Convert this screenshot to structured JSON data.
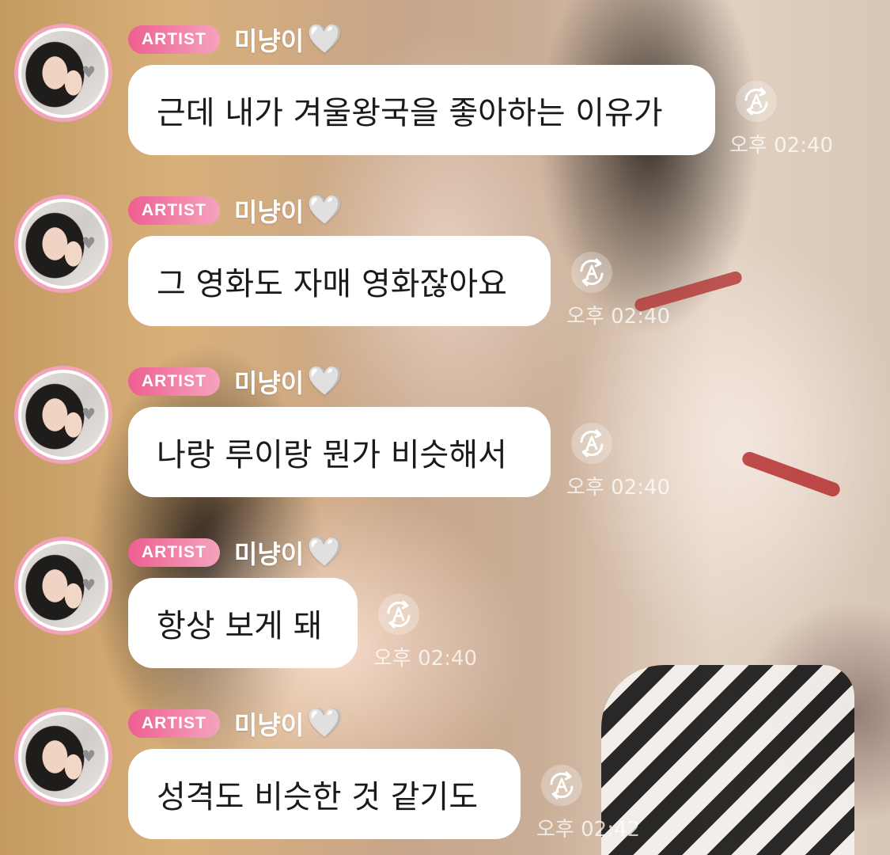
{
  "messages": [
    {
      "badge": "ARTIST",
      "name": "미냥이",
      "heart": "🤍",
      "text": "근데 내가 겨울왕국을 좋아하는 이유가",
      "time": "오후 02:40",
      "translate_icon": "translate-icon"
    },
    {
      "badge": "ARTIST",
      "name": "미냥이",
      "heart": "🤍",
      "text": "그 영화도 자매 영화잖아요",
      "time": "오후 02:40",
      "translate_icon": "translate-icon"
    },
    {
      "badge": "ARTIST",
      "name": "미냥이",
      "heart": "🤍",
      "text": "나랑 루이랑 뭔가 비슷해서",
      "time": "오후 02:40",
      "translate_icon": "translate-icon"
    },
    {
      "badge": "ARTIST",
      "name": "미냥이",
      "heart": "🤍",
      "text": "항상 보게 돼",
      "time": "오후 02:40",
      "translate_icon": "translate-icon"
    },
    {
      "badge": "ARTIST",
      "name": "미냥이",
      "heart": "🤍",
      "text": "성격도 비슷한 것 같기도",
      "time": "오후 02:42",
      "translate_icon": "translate-icon"
    }
  ],
  "colors": {
    "badge_start": "#ee5f92",
    "badge_end": "#f5a3bd",
    "avatar_ring": "#f3a4bd",
    "bubble": "#ffffff"
  }
}
